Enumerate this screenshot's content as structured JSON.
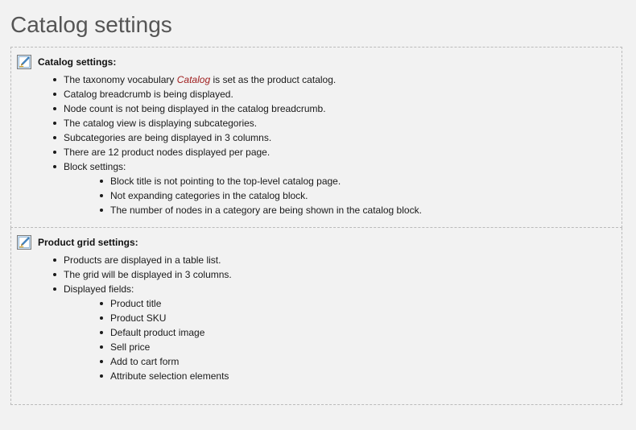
{
  "page": {
    "title": "Catalog settings",
    "background_color": "#f2f2f2",
    "title_color": "#555555",
    "accent_italic_color": "#a02020",
    "border_color": "#bbbbbb"
  },
  "panels": [
    {
      "icon": "edit-pencil-icon",
      "heading": "Catalog settings:",
      "items": [
        {
          "text_before": "The taxonomy vocabulary ",
          "emphasis": "Catalog",
          "text_after": " is set as the product catalog."
        },
        {
          "text": "Catalog breadcrumb is being displayed."
        },
        {
          "text": "Node count is not being displayed in the catalog breadcrumb."
        },
        {
          "text": "The catalog view is displaying subcategories."
        },
        {
          "text": "Subcategories are being displayed in 3 columns."
        },
        {
          "text": "There are 12 product nodes displayed per page."
        },
        {
          "text": "Block settings:",
          "children": [
            "Block title is not pointing to the top-level catalog page.",
            "Not expanding categories in the catalog block.",
            "The number of nodes in a category are being shown in the catalog block."
          ]
        }
      ]
    },
    {
      "icon": "edit-pencil-icon",
      "heading": "Product grid settings:",
      "items": [
        {
          "text": "Products are displayed in a table list."
        },
        {
          "text": "The grid will be displayed in 3 columns."
        },
        {
          "text": "Displayed fields:",
          "children": [
            "Product title",
            "Product SKU",
            "Default product image",
            "Sell price",
            "Add to cart form",
            "Attribute selection elements"
          ]
        }
      ]
    }
  ]
}
